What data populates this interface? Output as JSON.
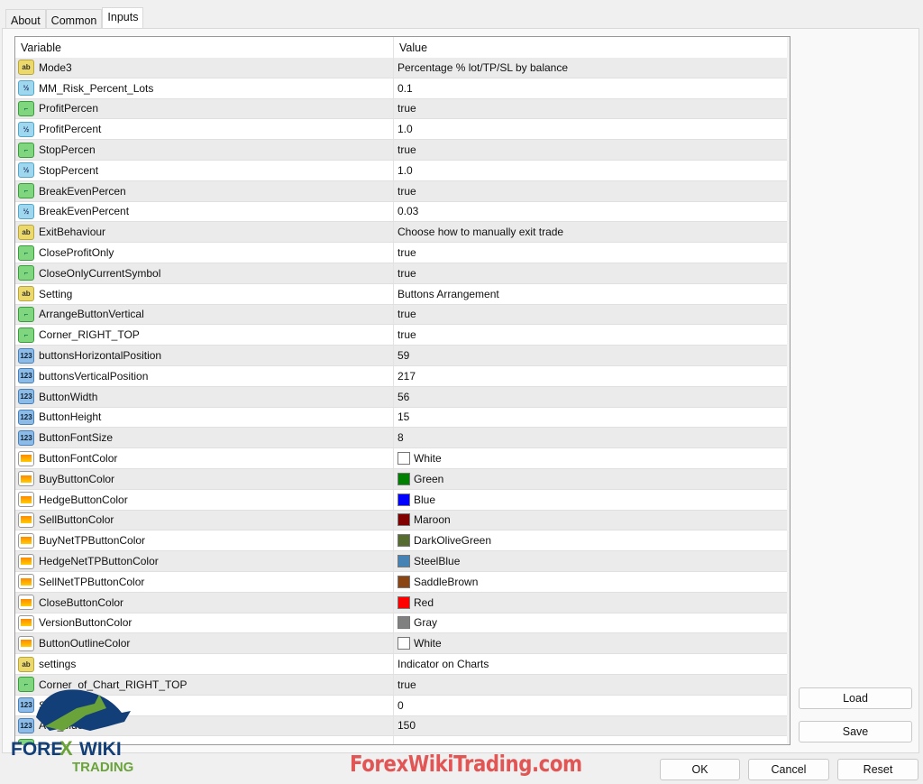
{
  "tabs": [
    {
      "label": "About"
    },
    {
      "label": "Common"
    },
    {
      "label": "Inputs",
      "active": true
    }
  ],
  "table": {
    "headers": {
      "variable": "Variable",
      "value": "Value"
    },
    "rows": [
      {
        "type": "string",
        "name": "Mode3",
        "value": "Percentage % lot/TP/SL by balance"
      },
      {
        "type": "double",
        "name": "MM_Risk_Percent_Lots",
        "value": "0.1"
      },
      {
        "type": "bool",
        "name": "ProfitPercen",
        "value": "true"
      },
      {
        "type": "double",
        "name": "ProfitPercent",
        "value": "1.0"
      },
      {
        "type": "bool",
        "name": "StopPercen",
        "value": "true"
      },
      {
        "type": "double",
        "name": "StopPercent",
        "value": "1.0"
      },
      {
        "type": "bool",
        "name": "BreakEvenPercen",
        "value": "true"
      },
      {
        "type": "double",
        "name": "BreakEvenPercent",
        "value": "0.03"
      },
      {
        "type": "string",
        "name": "ExitBehaviour",
        "value": "Choose how to manually exit trade"
      },
      {
        "type": "bool",
        "name": "CloseProfitOnly",
        "value": "true"
      },
      {
        "type": "bool",
        "name": "CloseOnlyCurrentSymbol",
        "value": "true"
      },
      {
        "type": "string",
        "name": "Setting",
        "value": "Buttons Arrangement"
      },
      {
        "type": "bool",
        "name": "ArrangeButtonVertical",
        "value": "true"
      },
      {
        "type": "bool",
        "name": "Corner_RIGHT_TOP",
        "value": "true"
      },
      {
        "type": "int",
        "name": "buttonsHorizontalPosition",
        "value": "59"
      },
      {
        "type": "int",
        "name": "buttonsVerticalPosition",
        "value": "217"
      },
      {
        "type": "int",
        "name": "ButtonWidth",
        "value": "56"
      },
      {
        "type": "int",
        "name": "ButtonHeight",
        "value": "15"
      },
      {
        "type": "int",
        "name": "ButtonFontSize",
        "value": "8"
      },
      {
        "type": "color",
        "name": "ButtonFontColor",
        "value": "White",
        "color": "#FFFFFF"
      },
      {
        "type": "color",
        "name": "BuyButtonColor",
        "value": "Green",
        "color": "#008000"
      },
      {
        "type": "color",
        "name": "HedgeButtonColor",
        "value": "Blue",
        "color": "#0000FF"
      },
      {
        "type": "color",
        "name": "SellButtonColor",
        "value": "Maroon",
        "color": "#800000"
      },
      {
        "type": "color",
        "name": "BuyNetTPButtonColor",
        "value": "DarkOliveGreen",
        "color": "#556B2F"
      },
      {
        "type": "color",
        "name": "HedgeNetTPButtonColor",
        "value": "SteelBlue",
        "color": "#4682B4"
      },
      {
        "type": "color",
        "name": "SellNetTPButtonColor",
        "value": "SaddleBrown",
        "color": "#8B4513"
      },
      {
        "type": "color",
        "name": "CloseButtonColor",
        "value": "Red",
        "color": "#FF0000"
      },
      {
        "type": "color",
        "name": "VersionButtonColor",
        "value": "Gray",
        "color": "#808080"
      },
      {
        "type": "color",
        "name": "ButtonOutlineColor",
        "value": "White",
        "color": "#FFFFFF"
      },
      {
        "type": "string",
        "name": "settings",
        "value": "Indicator on Charts"
      },
      {
        "type": "bool",
        "name": "Corner_of_Chart_RIGHT_TOP",
        "value": "true"
      },
      {
        "type": "int",
        "name": "S",
        "value": "0"
      },
      {
        "type": "int",
        "name": "A         to_side",
        "value": "150"
      },
      {
        "type": "bool",
        "name": "",
        "value": ""
      }
    ]
  },
  "buttons": {
    "load": "Load",
    "save": "Save",
    "ok": "OK",
    "cancel": "Cancel",
    "reset": "Reset"
  },
  "watermark": {
    "logo_text": "FOREX WIKI TRADING",
    "site": "ForexWikiTrading.com"
  }
}
